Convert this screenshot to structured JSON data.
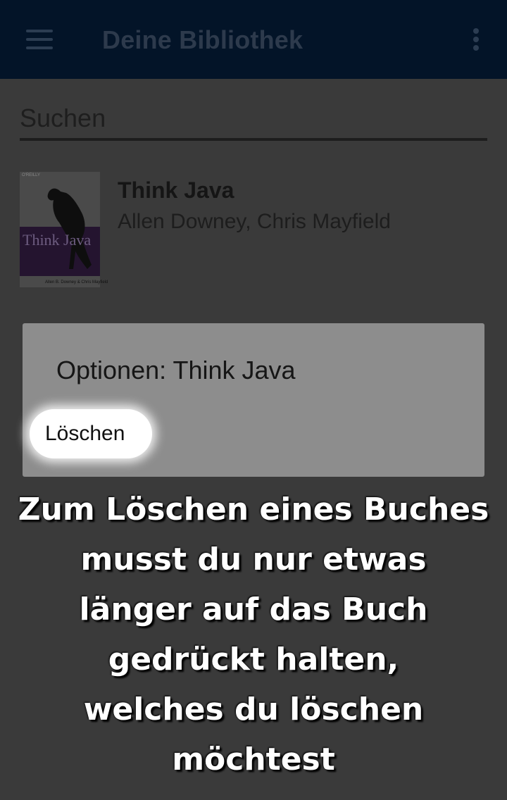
{
  "appbar": {
    "title": "Deine Bibliothek",
    "menu_icon": "hamburger-menu-icon",
    "overflow_icon": "more-vert-icon"
  },
  "search": {
    "placeholder": "Suchen"
  },
  "books": [
    {
      "title": "Think Java",
      "authors": "Allen Downey, Chris Mayfield",
      "cover": {
        "publisher": "O'REILLY",
        "title": "Think Java",
        "authors": "Allen B. Downey & Chris Mayfield"
      }
    }
  ],
  "dialog": {
    "title": "Optionen: Think Java",
    "delete_label": "Löschen"
  },
  "tutorial": {
    "lines": [
      "Zum Löschen eines Buches",
      "musst du nur etwas",
      "länger auf das Buch",
      "gedrückt halten,",
      "welches du löschen",
      "möchtest"
    ]
  },
  "colors": {
    "appbar": "#031428",
    "overlay_background": "#3a3a3a",
    "dialog": "#8d8d8d"
  }
}
